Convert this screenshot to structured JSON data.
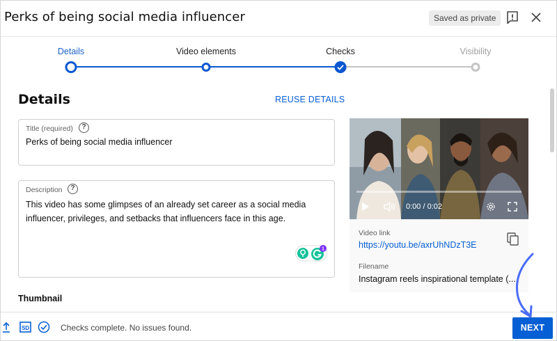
{
  "header": {
    "title": "Perks of being social media influencer",
    "saved_chip": "Saved as private",
    "feedback_icon": "feedback-icon",
    "close_icon": "close-icon"
  },
  "stepper": {
    "steps": [
      {
        "label": "Details",
        "state": "active"
      },
      {
        "label": "Video elements",
        "state": "visited"
      },
      {
        "label": "Checks",
        "state": "complete"
      },
      {
        "label": "Visibility",
        "state": "disabled"
      }
    ]
  },
  "details": {
    "section_title": "Details",
    "reuse_label": "REUSE DETAILS",
    "title_field": {
      "label": "Title (required)",
      "value": "Perks of being social media influencer"
    },
    "description_field": {
      "label": "Description",
      "value": "This video has some glimpses of an already set career as a social media influencer, privileges, and setbacks that influencers face in this age.",
      "grammarly_badge": "1"
    },
    "thumbnail_title": "Thumbnail"
  },
  "video": {
    "time": "0:00 / 0:02",
    "link_label": "Video link",
    "link": "https://youtu.be/axrUhNDzT3E",
    "filename_label": "Filename",
    "filename": "Instagram reels inspirational template (..."
  },
  "footer": {
    "status": "Checks complete. No issues found.",
    "next_label": "NEXT"
  },
  "colors": {
    "accent": "#065fd4",
    "step_blue": "#0b57d0",
    "annotation_arrow": "#4a6cf7"
  }
}
